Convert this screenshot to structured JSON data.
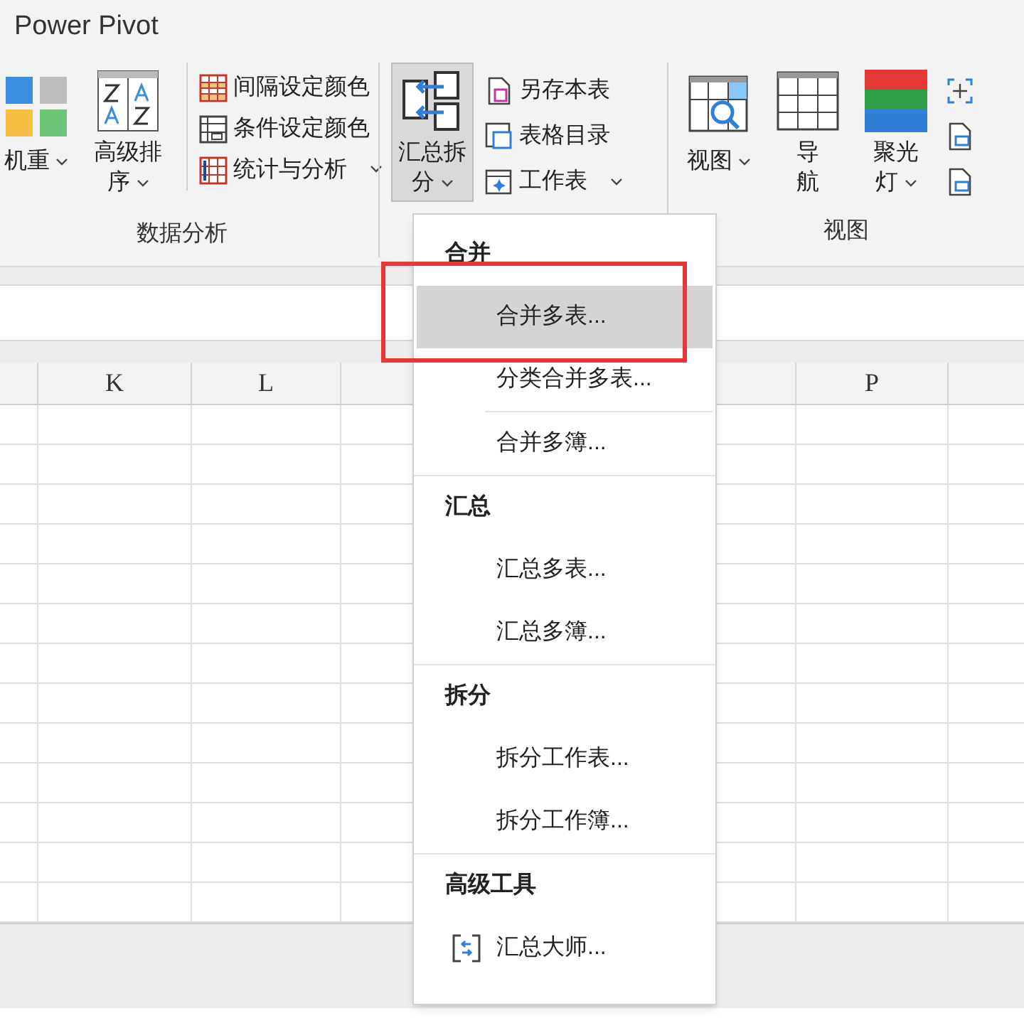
{
  "window": {
    "title": "Power Pivot"
  },
  "ribbon": {
    "groups": [
      {
        "kind": "data",
        "large": [
          {
            "lines": [
              "机重"
            ],
            "dropdown": true,
            "pressed": false
          },
          {
            "lines": [
              "高级排",
              "序"
            ],
            "dropdown": true,
            "pressed": false
          }
        ],
        "small": [
          {
            "label": "间隔设定颜色",
            "dropdown": false
          },
          {
            "label": "条件设定颜色",
            "dropdown": false
          },
          {
            "label": "统计与分析",
            "dropdown": true
          }
        ],
        "title": "数据分析"
      },
      {
        "kind": "merge",
        "large": [
          {
            "lines": [
              "汇总拆",
              "分"
            ],
            "dropdown": true,
            "pressed": true
          }
        ],
        "small": [
          {
            "label": "另存本表",
            "dropdown": false
          },
          {
            "label": "表格目录",
            "dropdown": false
          },
          {
            "label": "工作表",
            "dropdown": true
          }
        ]
      },
      {
        "kind": "view",
        "large": [
          {
            "lines": [
              "视图"
            ],
            "dropdown": true,
            "pressed": false
          },
          {
            "lines": [
              "导",
              "航"
            ],
            "dropdown": false,
            "pressed": false
          },
          {
            "lines": [
              "聚光",
              "灯"
            ],
            "dropdown": true,
            "pressed": false
          }
        ],
        "small": [
          {
            "dropdown": false
          },
          {
            "dropdown": false
          },
          {
            "dropdown": false
          }
        ],
        "title": "视图"
      }
    ]
  },
  "columns": [
    "K",
    "L",
    "P"
  ],
  "menu": {
    "sections": [
      {
        "title": "合并",
        "items": [
          {
            "label": "合并多表...",
            "selected": true
          },
          {
            "label": "分类合并多表...",
            "selected": false,
            "divider_after": true
          },
          {
            "label": "合并多簿...",
            "selected": false
          }
        ]
      },
      {
        "title": "汇总",
        "items": [
          {
            "label": "汇总多表...",
            "selected": false
          },
          {
            "label": "汇总多簿...",
            "selected": false
          }
        ]
      },
      {
        "title": "拆分",
        "items": [
          {
            "label": "拆分工作表...",
            "selected": false
          },
          {
            "label": "拆分工作簿...",
            "selected": false
          }
        ]
      },
      {
        "title": "高级工具",
        "items": [
          {
            "label": "汇总大师...",
            "selected": false,
            "has_icon": true
          }
        ]
      }
    ]
  },
  "highlight": {
    "on": true
  }
}
